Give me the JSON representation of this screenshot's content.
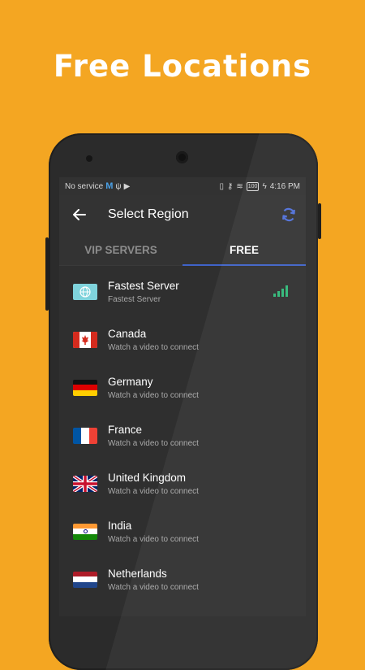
{
  "headline": "Free Locations",
  "statusbar": {
    "carrier": "No service",
    "time": "4:16 PM",
    "battery": "100"
  },
  "appbar": {
    "title": "Select Region",
    "back_icon": "back-arrow-icon",
    "refresh_icon": "refresh-icon"
  },
  "tabs": [
    {
      "label": "VIP SERVERS",
      "active": false
    },
    {
      "label": "FREE",
      "active": true
    }
  ],
  "servers": [
    {
      "name": "Fastest Server",
      "subtitle": "Fastest Server",
      "icon": "globe-icon"
    },
    {
      "name": "Canada",
      "subtitle": "Watch a video to connect",
      "icon": "flag-canada-icon"
    },
    {
      "name": "Germany",
      "subtitle": "Watch a video to connect",
      "icon": "flag-germany-icon"
    },
    {
      "name": "France",
      "subtitle": "Watch a video to connect",
      "icon": "flag-france-icon"
    },
    {
      "name": "United Kingdom",
      "subtitle": "Watch a video to connect",
      "icon": "flag-uk-icon"
    },
    {
      "name": "India",
      "subtitle": "Watch a video to connect",
      "icon": "flag-india-icon"
    },
    {
      "name": "Netherlands",
      "subtitle": "Watch a video to connect",
      "icon": "flag-netherlands-icon"
    }
  ],
  "colors": {
    "background": "#F4A622",
    "accent": "#3f63c8",
    "signal": "#2fb878"
  }
}
